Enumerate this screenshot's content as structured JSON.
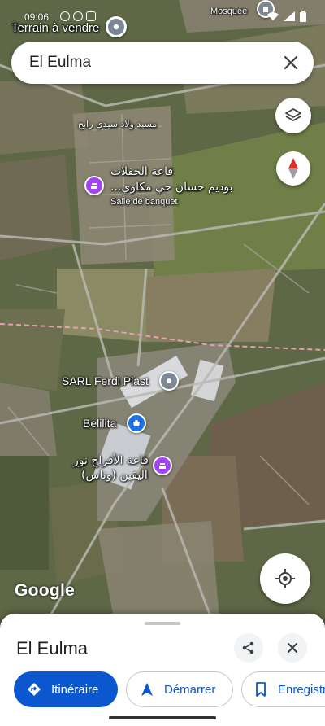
{
  "status_bar": {
    "time": "09:06"
  },
  "map_labels": {
    "terrain": "Terrain à vendre",
    "mosque": "Mosquée",
    "road_arabic": "مسيد ولاد سيدي رابح",
    "salle_arabic_1": "قاعة الحفلات",
    "salle_arabic_2": "بوديم حسان حي مكاوي...",
    "salle_fr": "Salle de banquet",
    "sarl": "SARL Ferdi Plast",
    "belilita": "Belilita",
    "noor_arabic_1": "قاعة الأفراح نور",
    "noor_arabic_2": "اليقين (وناس)",
    "google": "Google"
  },
  "search": {
    "query": "El Eulma"
  },
  "sheet": {
    "title": "El Eulma",
    "actions": [
      {
        "label": "Itinéraire",
        "icon": "directions-icon"
      },
      {
        "label": "Démarrer",
        "icon": "navigation-icon"
      },
      {
        "label": "Enregistrer",
        "icon": "bookmark-icon"
      }
    ]
  },
  "colors": {
    "accent": "#0b57d0",
    "poi_purple": "#a142f4",
    "poi_blue": "#1a73e8",
    "poi_gray": "#7d8896",
    "compass_red": "#d93025"
  }
}
